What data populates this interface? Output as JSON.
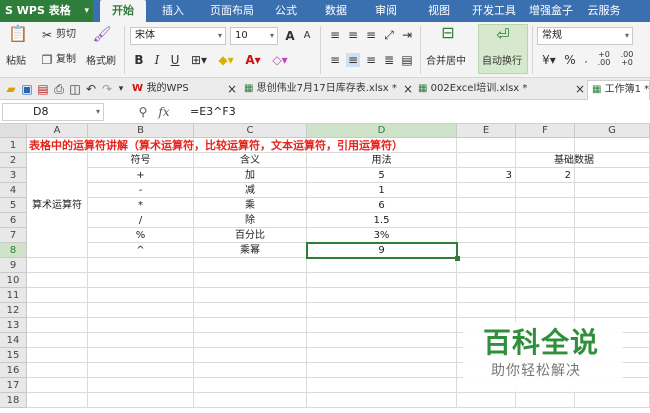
{
  "app": {
    "name": "WPS 表格"
  },
  "ribbon_tabs": [
    "开始",
    "插入",
    "页面布局",
    "公式",
    "数据",
    "审阅",
    "视图",
    "开发工具",
    "增强盒子",
    "云服务"
  ],
  "ribbon": {
    "paste": "粘贴",
    "cut": "剪切",
    "copy": "复制",
    "format_painter": "格式刷",
    "font_name": "宋体",
    "font_size": "10",
    "merge_center": "合并居中",
    "wrap_text": "自动换行",
    "number_format": "常规"
  },
  "doc_tabs": [
    {
      "label": "我的WPS"
    },
    {
      "label": "思创伟业7月17日库存表.xlsx *"
    },
    {
      "label": "002Excel培训.xlsx *"
    },
    {
      "label": "工作簿1 *"
    }
  ],
  "formula_bar": {
    "cell_ref": "D8",
    "fx": "fx",
    "formula": "=E3^F3"
  },
  "columns": [
    "A",
    "B",
    "C",
    "D",
    "E",
    "F",
    "G"
  ],
  "rows": [
    "1",
    "2",
    "3",
    "4",
    "5",
    "6",
    "7",
    "8",
    "9",
    "10",
    "11",
    "12",
    "13",
    "14",
    "15",
    "16",
    "17",
    "18"
  ],
  "sheet": {
    "title": "表格中的运算符讲解（算术运算符，比较运算符，文本运算符，引用运算符）",
    "headers": {
      "symbol": "符号",
      "meaning": "含义",
      "usage": "用法",
      "base": "基础数据"
    },
    "group_label": "算术运算符",
    "ops": [
      {
        "symbol": "+",
        "meaning": "加",
        "usage": "5"
      },
      {
        "symbol": "-",
        "meaning": "减",
        "usage": "1"
      },
      {
        "symbol": "*",
        "meaning": "乘",
        "usage": "6"
      },
      {
        "symbol": "/",
        "meaning": "除",
        "usage": "1.5"
      },
      {
        "symbol": "%",
        "meaning": "百分比",
        "usage": "3%"
      },
      {
        "symbol": "^",
        "meaning": "乘幂",
        "usage": "9"
      }
    ],
    "e3": "3",
    "f3": "2"
  },
  "watermark": {
    "title": "百科全说",
    "subtitle": "助你轻松解决"
  },
  "colors": {
    "title_red": "#e8221a",
    "accent_green": "#2f7d3a",
    "titlebar_blue": "#3a6fb0"
  }
}
